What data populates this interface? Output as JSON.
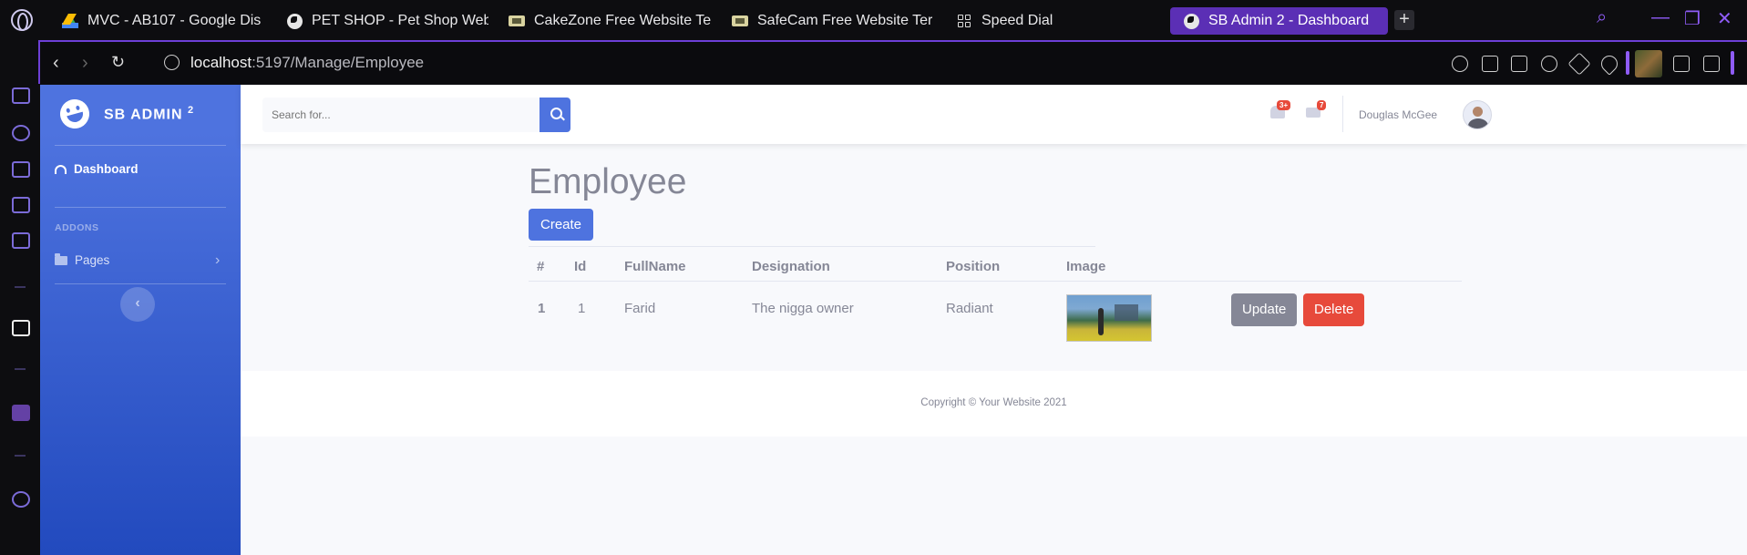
{
  "browser": {
    "tabs": [
      {
        "title": "MVC - AB107 - Google Dis",
        "icon": "google-drive-icon"
      },
      {
        "title": "PET SHOP - Pet Shop Web",
        "icon": "globe-icon"
      },
      {
        "title": "CakeZone Free Website Te",
        "icon": "site-thumbnail-icon"
      },
      {
        "title": "SafeCam Free Website Ter",
        "icon": "site-thumbnail-icon"
      },
      {
        "title": "Speed Dial",
        "icon": "speed-dial-icon"
      },
      {
        "title": "SB Admin 2 - Dashboard",
        "icon": "globe-icon",
        "active": true
      }
    ],
    "url_host": "localhost",
    "url_rest": ":5197/Manage/Employee",
    "accent": "#5b2fb5"
  },
  "app": {
    "brand_name": "SB ADMIN",
    "brand_sup": "2",
    "nav": {
      "dashboard": "Dashboard",
      "heading_addons": "ADDONS",
      "pages": "Pages"
    },
    "search_placeholder": "Search for...",
    "alerts_badge": "3+",
    "messages_badge": "7",
    "user_name": "Douglas McGee",
    "primary_color": "#4e73df",
    "danger_color": "#e74a3b"
  },
  "page": {
    "title": "Employee",
    "create_label": "Create",
    "columns": [
      "#",
      "Id",
      "FullName",
      "Designation",
      "Position",
      "Image"
    ],
    "rows": [
      {
        "index": "1",
        "id": "1",
        "full_name": "Farid",
        "designation": "The nigga owner",
        "position": "Radiant",
        "update_label": "Update",
        "delete_label": "Delete"
      }
    ]
  },
  "footer": {
    "copyright": "Copyright © Your Website 2021"
  }
}
